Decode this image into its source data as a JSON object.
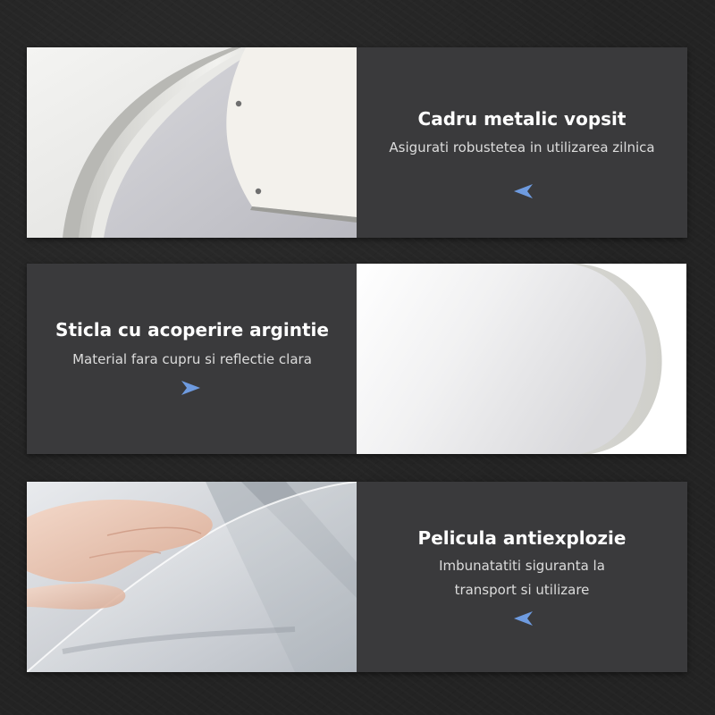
{
  "colors": {
    "background": "#232323",
    "panel": "#3a3a3c",
    "title": "#ffffff",
    "subtitle": "#dcdcdc",
    "arrow_accent": "#6e9be0"
  },
  "features": [
    {
      "title": "Cadru metalic vopsit",
      "subtitle": "Asigurati robustetea in utilizarea zilnica",
      "arrow_icon": "arrow-left-icon",
      "image": "painted-metal-frame-closeup"
    },
    {
      "title": "Sticla cu acoperire argintie",
      "subtitle": "Material fara cupru si reflectie clara",
      "arrow_icon": "arrow-right-icon",
      "image": "silver-coated-mirror-glass"
    },
    {
      "title": "Pelicula antiexplozie",
      "subtitle_line1": "Imbunatatiti siguranta la",
      "subtitle_line2": "transport si utilizare",
      "arrow_icon": "arrow-left-icon",
      "image": "hand-peeling-protective-film"
    }
  ]
}
